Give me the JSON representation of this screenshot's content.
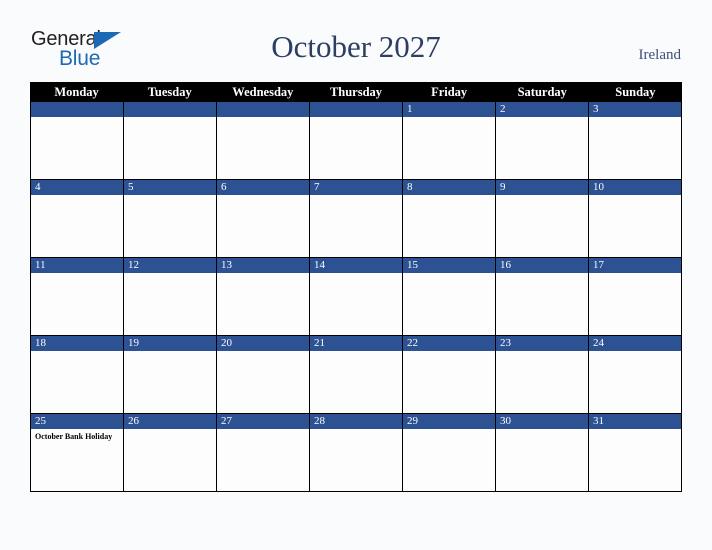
{
  "brand": {
    "name_top": "General",
    "name_bottom": "Blue",
    "accent_color": "#1c6ab5"
  },
  "header": {
    "title": "October 2027",
    "country": "Ireland"
  },
  "calendar": {
    "accent_color": "#2d5294",
    "header_bg": "#000000",
    "weekdays": [
      "Monday",
      "Tuesday",
      "Wednesday",
      "Thursday",
      "Friday",
      "Saturday",
      "Sunday"
    ],
    "weeks": [
      [
        {
          "date": "",
          "events": []
        },
        {
          "date": "",
          "events": []
        },
        {
          "date": "",
          "events": []
        },
        {
          "date": "",
          "events": []
        },
        {
          "date": "1",
          "events": []
        },
        {
          "date": "2",
          "events": []
        },
        {
          "date": "3",
          "events": []
        }
      ],
      [
        {
          "date": "4",
          "events": []
        },
        {
          "date": "5",
          "events": []
        },
        {
          "date": "6",
          "events": []
        },
        {
          "date": "7",
          "events": []
        },
        {
          "date": "8",
          "events": []
        },
        {
          "date": "9",
          "events": []
        },
        {
          "date": "10",
          "events": []
        }
      ],
      [
        {
          "date": "11",
          "events": []
        },
        {
          "date": "12",
          "events": []
        },
        {
          "date": "13",
          "events": []
        },
        {
          "date": "14",
          "events": []
        },
        {
          "date": "15",
          "events": []
        },
        {
          "date": "16",
          "events": []
        },
        {
          "date": "17",
          "events": []
        }
      ],
      [
        {
          "date": "18",
          "events": []
        },
        {
          "date": "19",
          "events": []
        },
        {
          "date": "20",
          "events": []
        },
        {
          "date": "21",
          "events": []
        },
        {
          "date": "22",
          "events": []
        },
        {
          "date": "23",
          "events": []
        },
        {
          "date": "24",
          "events": []
        }
      ],
      [
        {
          "date": "25",
          "events": [
            "October Bank Holiday"
          ]
        },
        {
          "date": "26",
          "events": []
        },
        {
          "date": "27",
          "events": []
        },
        {
          "date": "28",
          "events": []
        },
        {
          "date": "29",
          "events": []
        },
        {
          "date": "30",
          "events": []
        },
        {
          "date": "31",
          "events": []
        }
      ]
    ]
  }
}
